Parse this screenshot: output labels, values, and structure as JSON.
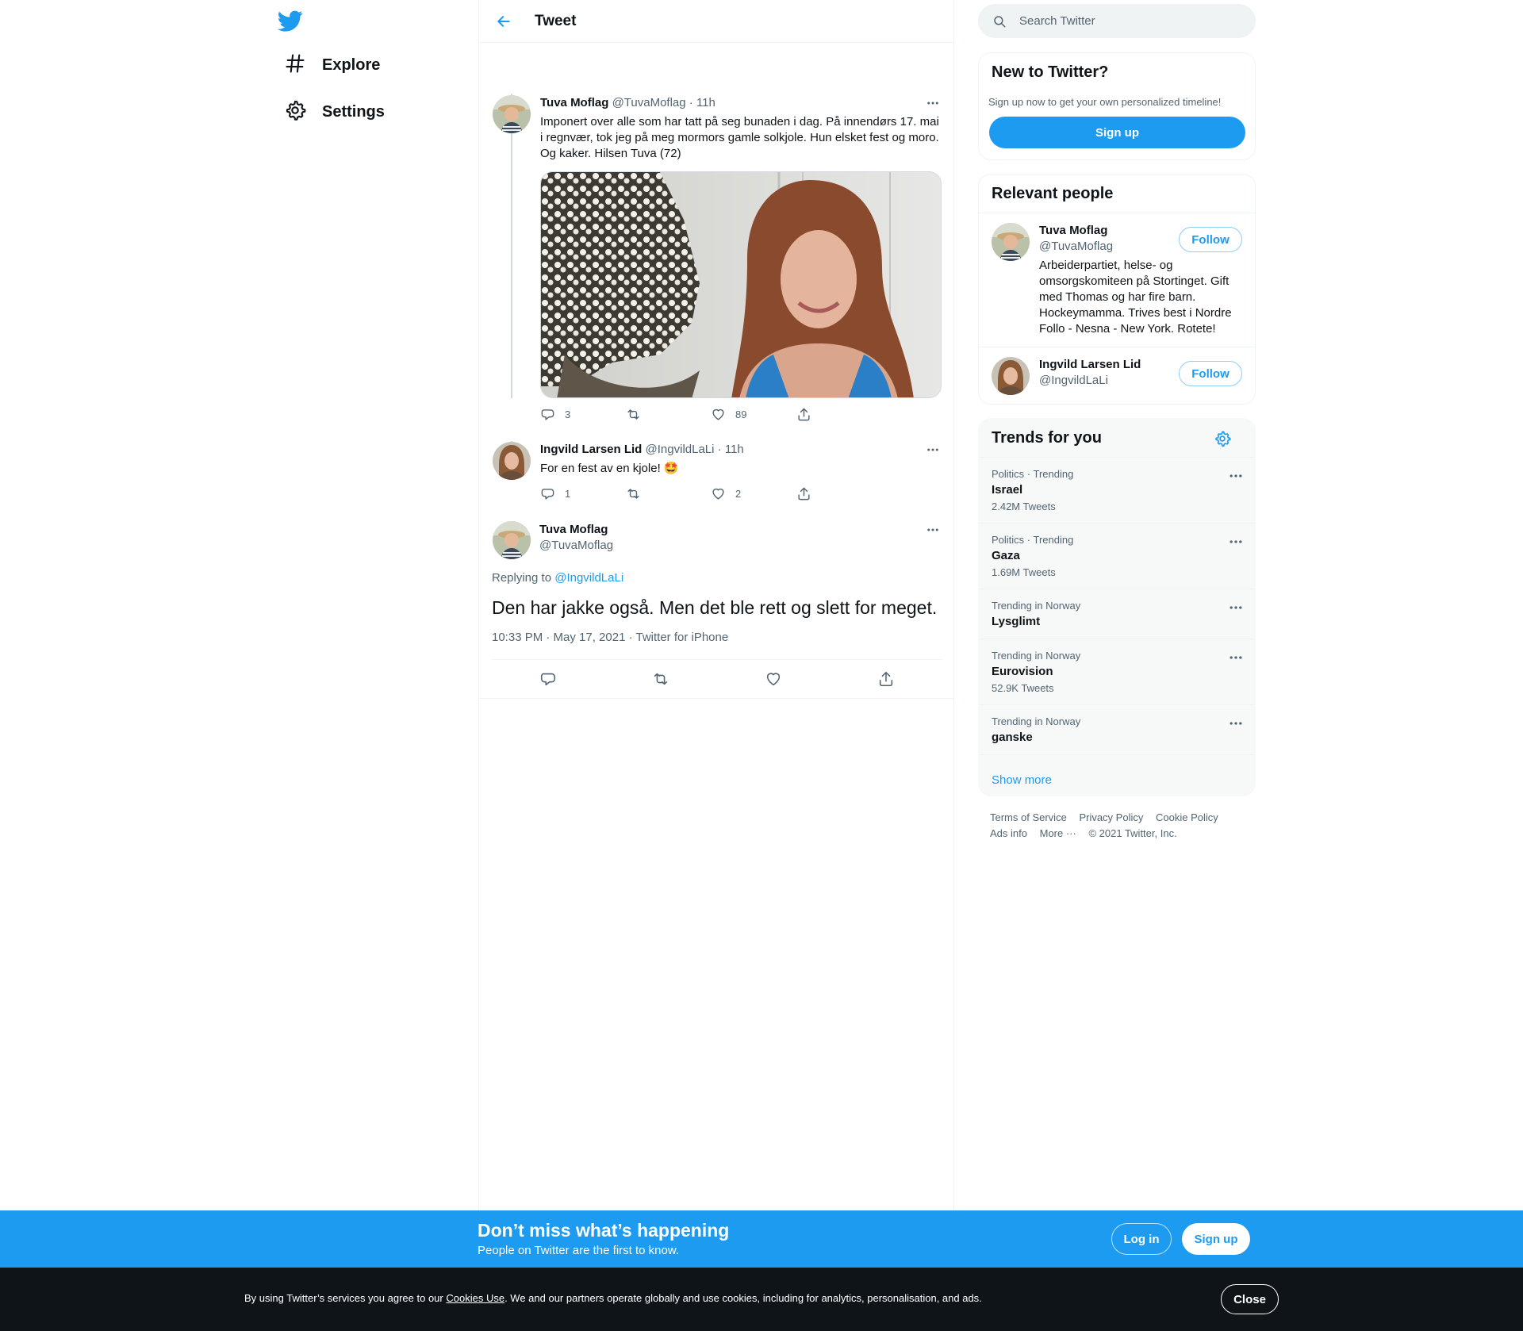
{
  "nav": {
    "items": [
      {
        "label": "Explore",
        "icon": "hashtag-icon"
      },
      {
        "label": "Settings",
        "icon": "gear-icon"
      }
    ]
  },
  "header": {
    "title": "Tweet"
  },
  "thread": [
    {
      "name": "Tuva Moflag",
      "handle": "@TuvaMoflag",
      "time": "· 11h",
      "text": "Imponert over alle som har tatt på seg bunaden i dag. På innendørs 17. mai i regnvær, tok jeg på meg mormors gamle solkjole. Hun elsket fest og moro. Og kaker. Hilsen Tuva (72)",
      "replies": "3",
      "retweets": "",
      "likes": "89"
    },
    {
      "name": "Ingvild Larsen Lid",
      "handle": "@IngvildLaLi",
      "time": "· 11h",
      "text": "For en fest av en kjole! 🤩",
      "replies": "1",
      "retweets": "",
      "likes": "2"
    }
  ],
  "focus": {
    "name": "Tuva Moflag",
    "handle": "@TuvaMoflag",
    "replying_prefix": "Replying to ",
    "replying_to": "@IngvildLaLi",
    "text": "Den har jakke også. Men det ble rett og slett for meget.",
    "meta": "10:33 PM · May 17, 2021 · Twitter for iPhone"
  },
  "search": {
    "placeholder": "Search Twitter"
  },
  "new_to_twitter": {
    "title": "New to Twitter?",
    "subtitle": "Sign up now to get your own personalized timeline!",
    "button": "Sign up"
  },
  "relevant_people": {
    "title": "Relevant people",
    "people": [
      {
        "name": "Tuva Moflag",
        "handle": "@TuvaMoflag",
        "bio": "Arbeiderpartiet, helse- og omsorgskomiteen på Stortinget. Gift med Thomas og har fire barn. Hockeymamma. Trives best i Nordre Follo - Nesna - New York. Rotete!",
        "button": "Follow"
      },
      {
        "name": "Ingvild Larsen Lid",
        "handle": "@IngvildLaLi",
        "bio": "",
        "button": "Follow"
      }
    ]
  },
  "trends": {
    "title": "Trends for you",
    "items": [
      {
        "meta": "Politics · Trending",
        "name": "Israel",
        "count": "2.42M Tweets"
      },
      {
        "meta": "Politics · Trending",
        "name": "Gaza",
        "count": "1.69M Tweets"
      },
      {
        "meta": "Trending in Norway",
        "name": "Lysglimt",
        "count": ""
      },
      {
        "meta": "Trending in Norway",
        "name": "Eurovision",
        "count": "52.9K Tweets"
      },
      {
        "meta": "Trending in Norway",
        "name": "ganske",
        "count": ""
      }
    ],
    "show_more": "Show more"
  },
  "footer": {
    "links": [
      "Terms of Service",
      "Privacy Policy",
      "Cookie Policy",
      "Ads info",
      "More ···",
      "© 2021 Twitter, Inc."
    ]
  },
  "banner": {
    "title": "Don’t miss what’s happening",
    "subtitle": "People on Twitter are the first to know.",
    "login": "Log in",
    "signup": "Sign up"
  },
  "cookie": {
    "prefix": "By using Twitter’s services you agree to our ",
    "link": "Cookies Use",
    "suffix": ". We and our partners operate globally and use cookies, including for analytics, personalisation, and ads.",
    "close": "Close"
  },
  "colors": {
    "brand": "#1d9bf0",
    "text": "#0f1419",
    "secondary": "#536471",
    "dark": "#0f1419"
  }
}
